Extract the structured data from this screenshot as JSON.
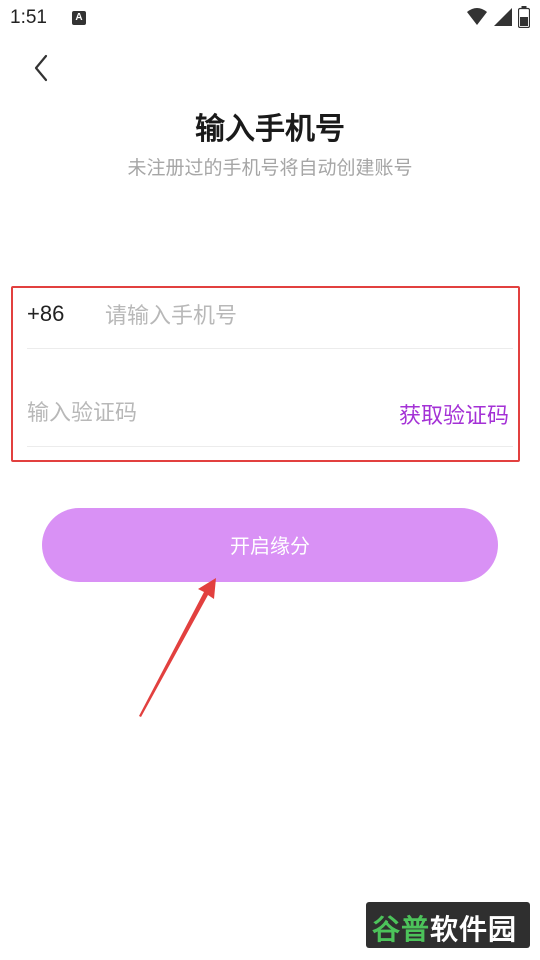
{
  "status_bar": {
    "time": "1:51",
    "notification_letter": "A",
    "icons": [
      "wifi-icon",
      "signal-icon",
      "battery-icon"
    ]
  },
  "header": {
    "back_icon": "chevron-left-icon",
    "title": "输入手机号",
    "subtitle": "未注册过的手机号将自动创建账号"
  },
  "form": {
    "country_code": "+86",
    "phone_placeholder": "请输入手机号",
    "phone_value": "",
    "code_placeholder": "输入验证码",
    "code_value": "",
    "get_code_label": "获取验证码"
  },
  "submit_label": "开启缘分",
  "watermark": {
    "text_green": "谷普",
    "text_white": "软件园"
  },
  "colors": {
    "accent_purple": "#a431d6",
    "button_bg": "#d991f5",
    "highlight_red": "#e2403f"
  }
}
